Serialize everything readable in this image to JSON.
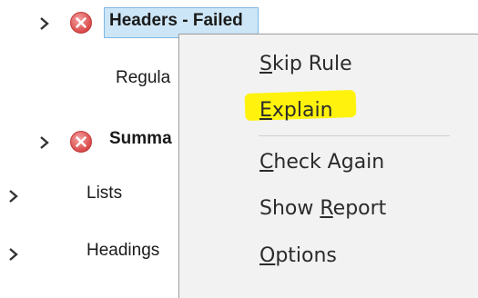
{
  "tree": {
    "items": [
      {
        "label": "Headers - Failed",
        "status": "failed",
        "expanded": false,
        "selected": true
      },
      {
        "label": "Regula",
        "status": "none",
        "child": true
      },
      {
        "label": "Summa",
        "status": "failed",
        "expanded": false
      },
      {
        "label": "Lists",
        "status": "none"
      },
      {
        "label": "Headings",
        "status": "none"
      }
    ],
    "icons": {
      "chevron": "chevron-right-icon",
      "failed": "error-x-icon"
    }
  },
  "context_menu": {
    "items": [
      {
        "pre": "",
        "u": "S",
        "post": "kip Rule"
      },
      {
        "pre": "",
        "u": "E",
        "post": "xplain"
      },
      {
        "pre": "",
        "u": "C",
        "post": "heck Again"
      },
      {
        "pre": "Show ",
        "u": "R",
        "post": "eport"
      },
      {
        "pre": "",
        "u": "O",
        "post": "ptions"
      }
    ],
    "highlighted_item": "Explain",
    "highlight_color": "#fff200"
  },
  "colors": {
    "selection_bg": "#cde6f7",
    "error_icon": "#e05a5a",
    "menu_bg": "#f2f2f2"
  }
}
